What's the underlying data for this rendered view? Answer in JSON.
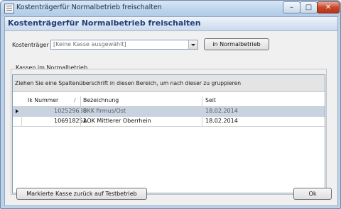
{
  "window": {
    "title": "Kostenträgerfür Normalbetrieb freischalten",
    "min_icon": "minimize-icon",
    "max_icon": "maximize-icon",
    "close_icon": "close-icon"
  },
  "header": {
    "title": "Kostenträgerfür Normalbetrieb freischalten"
  },
  "filter": {
    "label": "Kostenträger",
    "combo_value": "[Keine Kasse ausgewählt]",
    "button_label": "in Normalbetrieb"
  },
  "group": {
    "caption": "Kassen im Normalbetrieb",
    "group_hint": "Ziehen Sie eine Spaltenüberschrift in diesen Bereich, um nach dieser zu gruppieren",
    "columns": [
      "Ik Nummer",
      "/",
      "Bezeichnung",
      "Seit"
    ],
    "rows": [
      {
        "ik": "102529638",
        "name": "BKK firmus/Ost",
        "since": "18.02.2014",
        "selected": true
      },
      {
        "ik": "106918251",
        "name": "AOK Mittlerer Oberrhein",
        "since": "18.02.2014",
        "selected": false
      }
    ]
  },
  "footer": {
    "back_button": "Markierte Kasse zurück auf Testbetrieb",
    "ok_button": "Ok"
  },
  "colors": {
    "accent": "#1f3e7a",
    "selection": "#c8d3e2"
  }
}
